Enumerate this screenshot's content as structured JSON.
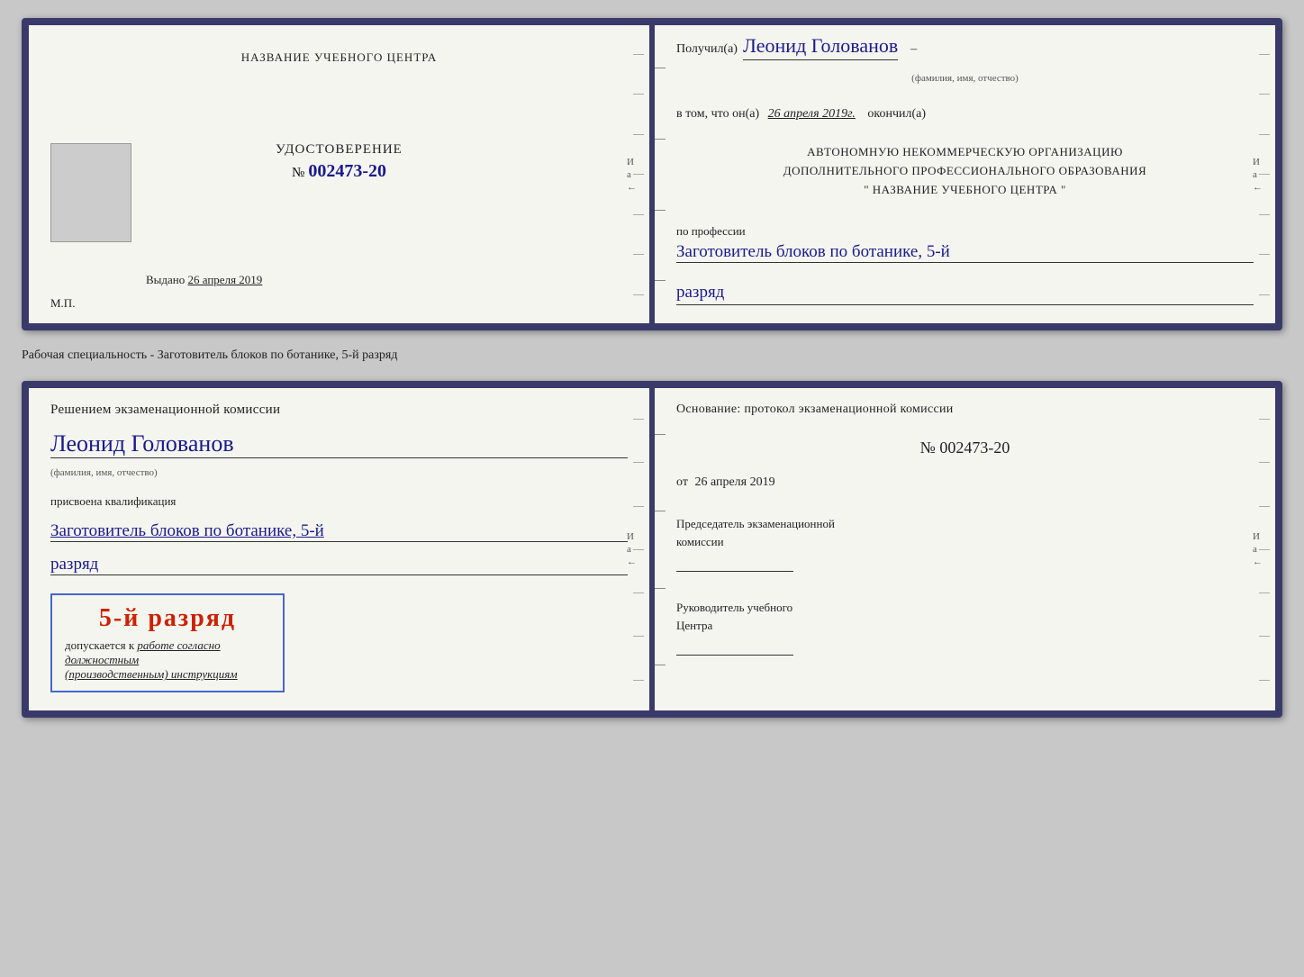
{
  "top_card": {
    "left": {
      "training_center_label": "НАЗВАНИЕ УЧЕБНОГО ЦЕНТРА",
      "cert_type": "УДОСТОВЕРЕНИЕ",
      "cert_number_prefix": "№",
      "cert_number": "002473-20",
      "issued_prefix": "Выдано",
      "issued_date": "26 апреля 2019",
      "mp_label": "М.П."
    },
    "right": {
      "received_prefix": "Получил(а)",
      "person_name": "Леонид Голованов",
      "fio_hint": "(фамилия, имя, отчество)",
      "date_prefix": "в том, что он(а)",
      "date_val": "26 апреля 2019г.",
      "date_suffix": "окончил(а)",
      "org_line1": "АВТОНОМНУЮ НЕКОММЕРЧЕСКУЮ ОРГАНИЗАЦИЮ",
      "org_line2": "ДОПОЛНИТЕЛЬНОГО ПРОФЕССИОНАЛЬНОГО ОБРАЗОВАНИЯ",
      "org_line3": "\"  НАЗВАНИЕ УЧЕБНОГО ЦЕНТРА  \"",
      "profession_prefix": "по профессии",
      "profession_val": "Заготовитель блоков по ботанике, 5-й",
      "rank_val": "разряд"
    }
  },
  "specialty_text": "Рабочая специальность - Заготовитель блоков по ботанике, 5-й разряд",
  "bottom_card": {
    "left": {
      "commission_decision": "Решением экзаменационной комиссии",
      "person_name": "Леонид Голованов",
      "fio_hint": "(фамилия, имя, отчество)",
      "qual_assigned": "присвоена квалификация",
      "qual_val": "Заготовитель блоков по ботанике, 5-й",
      "rank_val": "разряд",
      "grade_title": "5-й разряд",
      "grade_prefix": "допускается к",
      "grade_italic": "работе согласно должностным",
      "grade_italic2": "(производственным) инструкциям"
    },
    "right": {
      "basis_title": "Основание: протокол экзаменационной комиссии",
      "proto_number": "№  002473-20",
      "proto_date_prefix": "от",
      "proto_date": "26 апреля 2019",
      "chairman_label": "Председатель экзаменационной",
      "chairman_label2": "комиссии",
      "head_label": "Руководитель учебного",
      "head_label2": "Центра"
    }
  }
}
